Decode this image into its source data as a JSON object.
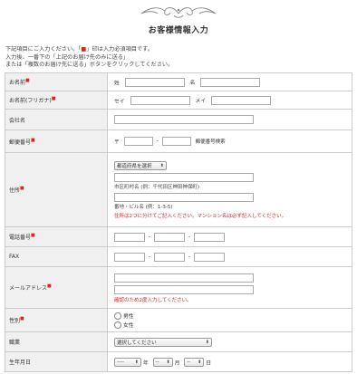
{
  "header": {
    "title": "お客様情報入力"
  },
  "intro": {
    "line1_pre": "下記項目にご入力ください。「",
    "line1_mark": "■",
    "line1_post": "」印は入力必須項目です。",
    "line2": "入力後、一番下の「上記のお届け先のみに送る」",
    "line3": "または「複数のお届け先に送る」ボタンをクリックしてください。"
  },
  "required_mark": "■",
  "fields": {
    "name": {
      "label": "お名前",
      "sei": "姓",
      "mei": "名"
    },
    "kana": {
      "label": "お名前(フリガナ)",
      "sei": "セイ",
      "mei": "メイ"
    },
    "company": {
      "label": "会社名"
    },
    "zip": {
      "label": "郵便番号",
      "prefix": "〒",
      "dash": "-",
      "search_link": "郵便番号検索"
    },
    "address": {
      "label": "住所",
      "pref_select": "都道府県を選択",
      "hint1": "市区町村名 (例：千代田区神田神保町)",
      "hint2": "番地・ビル名 (例：1-3-5)",
      "note": "住所は2つに分けてご記入ください。マンション名は必ず記入してください。"
    },
    "tel": {
      "label": "電話番号",
      "dash": "-"
    },
    "fax": {
      "label": "FAX",
      "dash": "-"
    },
    "email": {
      "label": "メールアドレス",
      "note": "確認のため2度入力してください。"
    },
    "gender": {
      "label": "性別",
      "options": [
        "男性",
        "女性"
      ]
    },
    "job": {
      "label": "職業",
      "select": "選択してください"
    },
    "birth": {
      "label": "生年月日",
      "year_sel": "----",
      "year": "年",
      "month_sel": "--",
      "month": "月",
      "day_sel": "--",
      "day": "日"
    }
  },
  "colors": {
    "required": "#dd2222",
    "label_bg": "#f0f0f0",
    "border": "#cccccc"
  }
}
